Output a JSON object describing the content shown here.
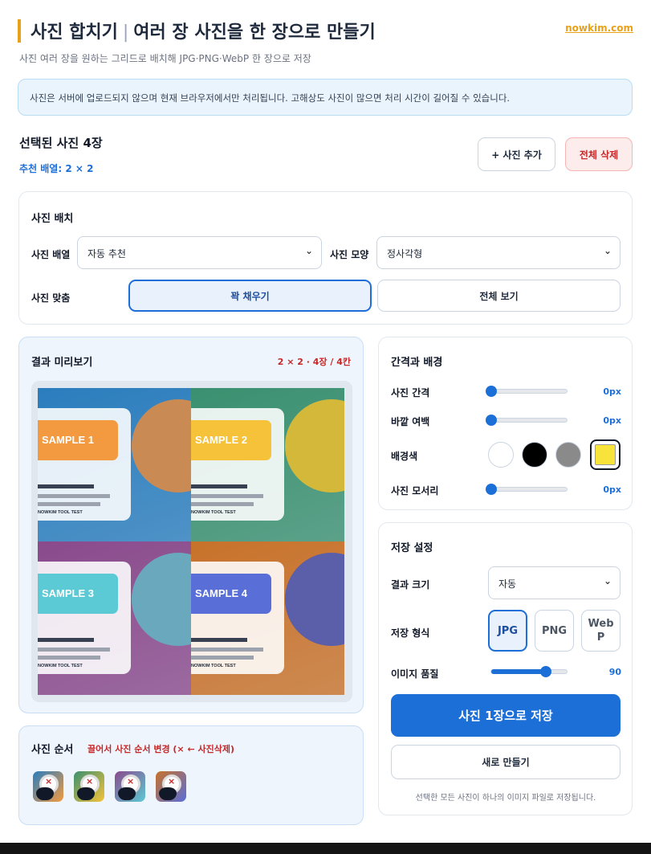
{
  "header": {
    "title": "사진 합치기",
    "separator": "|",
    "title_suffix": "여러 장 사진을 한 장으로 만들기",
    "site": "nowkim.com",
    "subtitle": "사진 여러 장을 원하는 그리드로 배치해 JPG·PNG·WebP 한 장으로 저장"
  },
  "notice": "사진은 서버에 업로드되지 않으며 현재 브라우저에서만 처리됩니다. 고해상도 사진이 많으면 처리 시간이 길어질 수 있습니다.",
  "selection": {
    "title": "선택된 사진 4장",
    "recommend": "추천 배열: 2 × 2",
    "add_button": "+ 사진 추가",
    "clear_button": "전체 삭제"
  },
  "layout": {
    "title": "사진 배치",
    "arrangement_label": "사진 배열",
    "arrangement_value": "자동 추천",
    "shape_label": "사진 모양",
    "shape_value": "정사각형",
    "fit_label": "사진 맞춤",
    "fit_options": [
      "꽉 채우기",
      "전체 보기"
    ],
    "fit_selected": "꽉 채우기"
  },
  "preview": {
    "title": "결과 미리보기",
    "status": "2 × 2 · 4장 / 4칸",
    "tiles": [
      {
        "label": "SAMPLE 1",
        "footer": "NOWKIM TOOL TEST",
        "bg": "#2a7dbd",
        "pill": "#f39a40",
        "circle": "#c98a54"
      },
      {
        "label": "SAMPLE 2",
        "footer": "NOWKIM TOOL TEST",
        "bg": "#3a9070",
        "pill": "#f5c23a",
        "circle": "#d3b83a"
      },
      {
        "label": "SAMPLE 3",
        "footer": "NOWKIM TOOL TEST",
        "bg": "#8a4a8c",
        "pill": "#5ccad4",
        "circle": "#6aa8bd"
      },
      {
        "label": "SAMPLE 4",
        "footer": "NOWKIM TOOL TEST",
        "bg": "#c8722a",
        "pill": "#5a6ed8",
        "circle": "#5b5ea8"
      }
    ]
  },
  "order": {
    "title": "사진 순서",
    "hint": "끌어서 사진 순서 변경 (× ← 사진삭제)",
    "thumbs": [
      {
        "remove": "×",
        "bg": "#2a7dbd",
        "accent": "#f39a40"
      },
      {
        "remove": "×",
        "bg": "#3a9070",
        "accent": "#f5c23a"
      },
      {
        "remove": "×",
        "bg": "#8a4a8c",
        "accent": "#5ccad4"
      },
      {
        "remove": "×",
        "bg": "#c8722a",
        "accent": "#5a6ed8"
      }
    ]
  },
  "spacing": {
    "title": "간격과 배경",
    "gap_label": "사진 간격",
    "gap_value": "0px",
    "gap_fraction": 0,
    "margin_label": "바깥 여백",
    "margin_value": "0px",
    "margin_fraction": 0,
    "bg_label": "배경색",
    "bg_colors": [
      "#ffffff",
      "#000000",
      "#8a8a8a",
      "#f7e33a"
    ],
    "bg_selected": "#f7e33a",
    "radius_label": "사진 모서리",
    "radius_value": "0px",
    "radius_fraction": 0
  },
  "save": {
    "title": "저장 설정",
    "size_label": "결과 크기",
    "size_value": "자동",
    "format_label": "저장 형식",
    "formats": [
      "JPG",
      "PNG",
      "WebP"
    ],
    "format_selected": "JPG",
    "quality_label": "이미지 품질",
    "quality_value": "90",
    "quality_fraction": 0.72,
    "save_button": "사진 1장으로 저장",
    "new_button": "새로 만들기",
    "footnote": "선택한 모든 사진이 하나의 이미지 파일로 저장됩니다."
  },
  "icons": {
    "chevron": "chevron-down-icon",
    "remove": "close-icon"
  }
}
